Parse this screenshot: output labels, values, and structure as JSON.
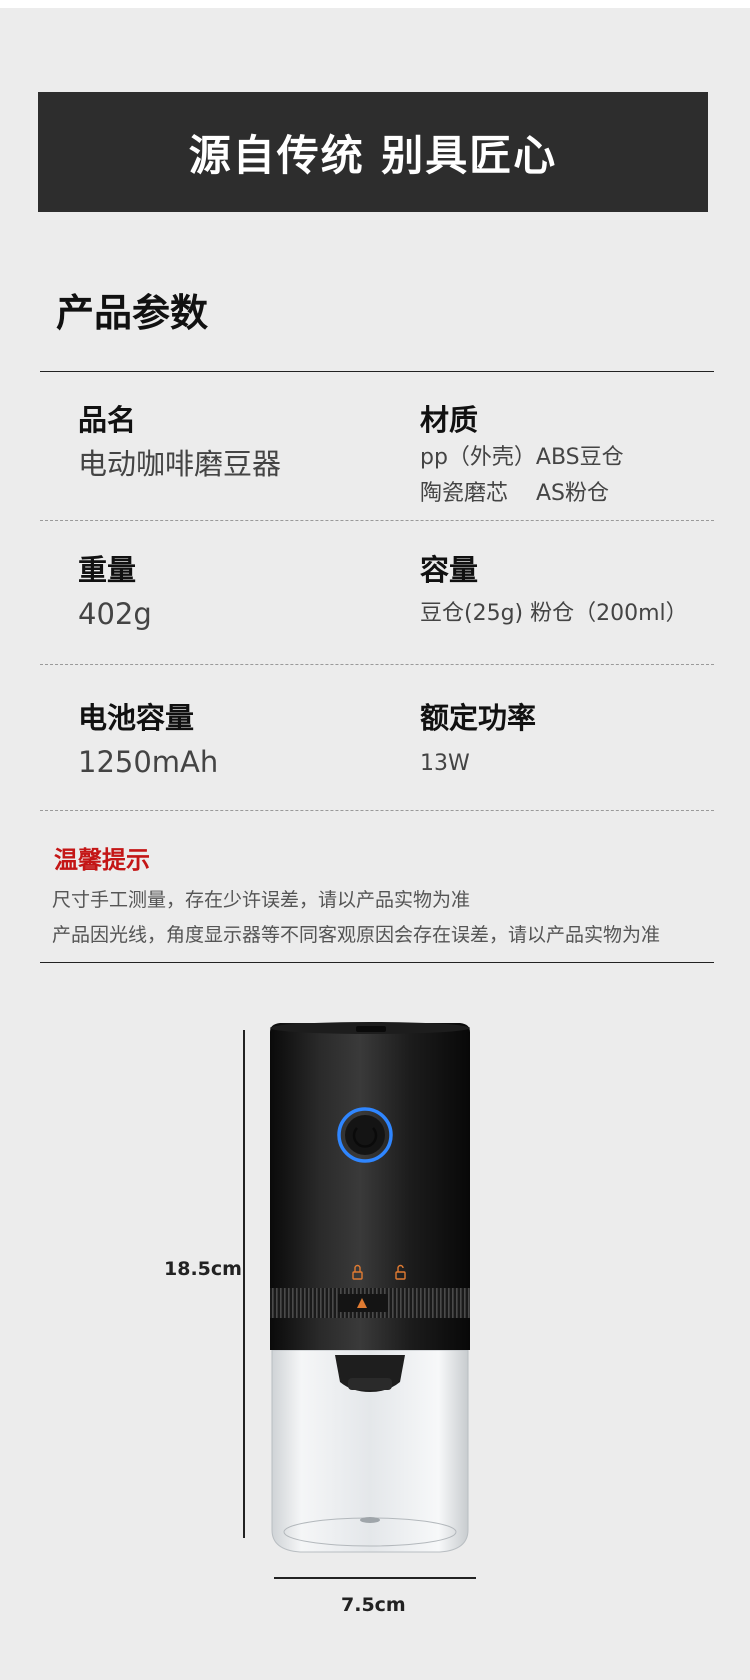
{
  "banner": {
    "title": "源自传统 别具匠心"
  },
  "section": {
    "title": "产品参数"
  },
  "specs": [
    {
      "label": "品名",
      "value": "电动咖啡磨豆器"
    },
    {
      "label": "材质",
      "value_lines": [
        "pp（外壳）ABS豆仓",
        "陶瓷磨芯    AS粉仓"
      ]
    },
    {
      "label": "重量",
      "value": "402g"
    },
    {
      "label": "容量",
      "value": "豆仓(25g) 粉仓（200ml）"
    },
    {
      "label": "电池容量",
      "value": "1250mAh"
    },
    {
      "label": "额定功率",
      "value": "13W"
    }
  ],
  "tips": {
    "title": "温馨提示",
    "lines": [
      "尺寸手工测量，存在少许误差，请以产品实物为准",
      "产品因光线，角度显示器等不同客观原因会存在误差，请以产品实物为准"
    ]
  },
  "dimensions": {
    "height": "18.5cm",
    "width": "7.5cm"
  },
  "product": {
    "icons": [
      "power-icon",
      "lock-icon",
      "unlock-icon",
      "arrow-up-icon"
    ],
    "colors": {
      "body": "#141414",
      "ring": "#2f86ff",
      "indicator": "#e07b32",
      "glass": "#d9dde0"
    }
  }
}
